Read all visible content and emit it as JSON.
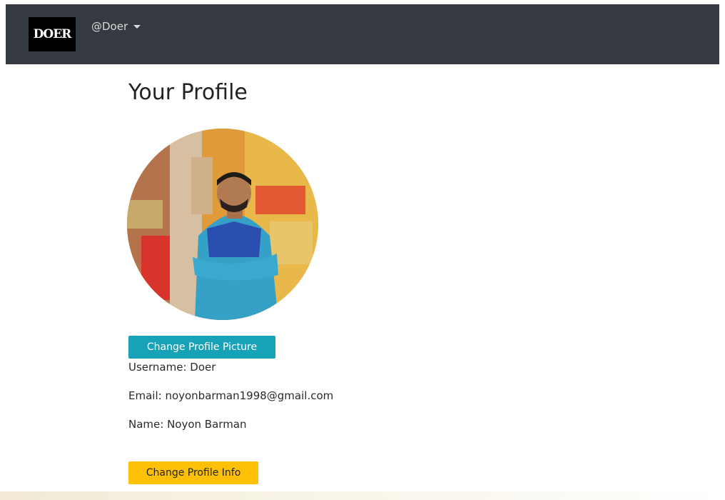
{
  "navbar": {
    "brand": "DOER",
    "user_menu_label": "@Doer"
  },
  "profile": {
    "title": "Your Profile",
    "change_picture_label": "Change Profile Picture",
    "username_line": "Username: Doer",
    "email_line": "Email: noyonbarman1998@gmail.com",
    "name_line": "Name: Noyon Barman",
    "change_info_label": "Change Profile Info"
  },
  "colors": {
    "navbar_bg": "#343a40",
    "info_button": "#17a2b8",
    "warning_button": "#ffc107"
  }
}
